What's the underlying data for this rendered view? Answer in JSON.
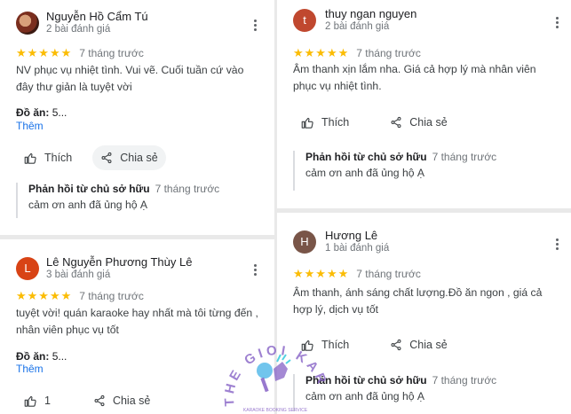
{
  "reviews": [
    {
      "name": "Nguyễn Hồ Cẩm Tú",
      "count": "2 bài đánh giá",
      "stars": "★★★★★",
      "time": "7 tháng trước",
      "text": "NV phục vụ nhiệt tình. Vui vẽ. Cuối tuần cứ vào đây thư giản là tuyệt vời",
      "food_label": "Đồ ăn:",
      "food_value": "5...",
      "more_link": "Thêm",
      "like": "Thích",
      "share": "Chia sẻ",
      "reply_title": "Phản hồi từ chủ sở hữu",
      "reply_time": "7 tháng trước",
      "reply_text": "cảm ơn anh đã ủng hộ Ạ"
    },
    {
      "name": "Lê Nguyễn Phương Thùy Lê",
      "avatar_letter": "L",
      "count": "3 bài đánh giá",
      "stars": "★★★★★",
      "time": "7 tháng trước",
      "text": "tuyệt vời! quán karaoke hay nhất mà tôi từng đến , nhân viên phục vụ tốt",
      "food_label": "Đồ ăn:",
      "food_value": "5...",
      "more_link": "Thêm",
      "like_count": "1",
      "share": "Chia sẻ"
    },
    {
      "name": "thuy ngan nguyen",
      "avatar_letter": "t",
      "count": "2 bài đánh giá",
      "stars": "★★★★★",
      "time": "7 tháng trước",
      "text": "Âm thanh xịn lắm nha. Giá cả hợp lý mà nhân viên phục vụ nhiệt tình.",
      "like": "Thích",
      "share": "Chia sẻ",
      "reply_title": "Phản hồi từ chủ sở hữu",
      "reply_time": "7 tháng trước",
      "reply_text": "cảm ơn anh đã ủng hộ Ạ"
    },
    {
      "name": "Hương Lê",
      "avatar_letter": "H",
      "count": "1 bài đánh giá",
      "stars": "★★★★★",
      "time": "7 tháng trước",
      "text": "Âm thanh, ánh sáng chất lượng.Đồ ăn ngon , giá cả hợp lý, dịch vụ tốt",
      "like": "Thích",
      "share": "Chia sẻ",
      "reply_title": "Phản hồi từ chủ sở hữu",
      "reply_time": "7 tháng trước",
      "reply_text": "cảm ơn anh đã ủng hộ Ạ"
    }
  ],
  "watermark": {
    "brand": "THE GIOI KARAOKE",
    "tagline": "KARAOKE BOOKING SERVICE"
  },
  "icons": {
    "like": "thumbs-up-icon",
    "share": "share-icon",
    "more": "more-vert-icon"
  },
  "colors": {
    "star": "#fbbc04",
    "link": "#1a73e8",
    "avatar_t": "#c0482f",
    "avatar_l": "#d84315",
    "avatar_h": "#795548"
  }
}
